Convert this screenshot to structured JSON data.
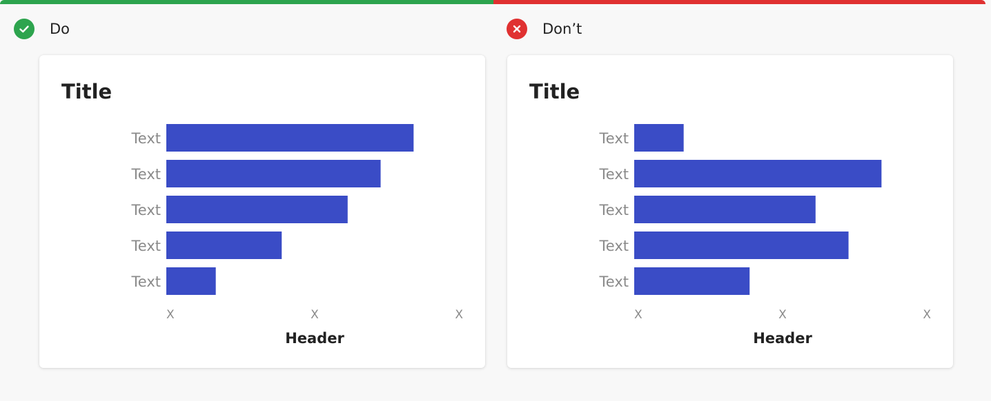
{
  "colors": {
    "do_accent": "#2da44e",
    "dont_accent": "#e03131",
    "bar": "#3a4cc6",
    "label": "#8a8a8a",
    "title": "#222222"
  },
  "panels": [
    {
      "id": "do",
      "label": "Do",
      "icon": "check-circle-icon"
    },
    {
      "id": "dont",
      "label": "Don’t",
      "icon": "x-circle-icon"
    }
  ],
  "chart_data": [
    {
      "type": "bar",
      "orientation": "horizontal",
      "title": "Title",
      "xlabel": "Header",
      "categories": [
        "Text",
        "Text",
        "Text",
        "Text",
        "Text"
      ],
      "values": [
        75,
        65,
        55,
        35,
        15
      ],
      "xlim": [
        0,
        90
      ],
      "x_tick_labels": [
        "X",
        "X",
        "X"
      ],
      "grid": false
    },
    {
      "type": "bar",
      "orientation": "horizontal",
      "title": "Title",
      "xlabel": "Header",
      "categories": [
        "Text",
        "Text",
        "Text",
        "Text",
        "Text"
      ],
      "values": [
        15,
        75,
        55,
        65,
        35
      ],
      "xlim": [
        0,
        90
      ],
      "x_tick_labels": [
        "X",
        "X",
        "X"
      ],
      "grid": false
    }
  ]
}
